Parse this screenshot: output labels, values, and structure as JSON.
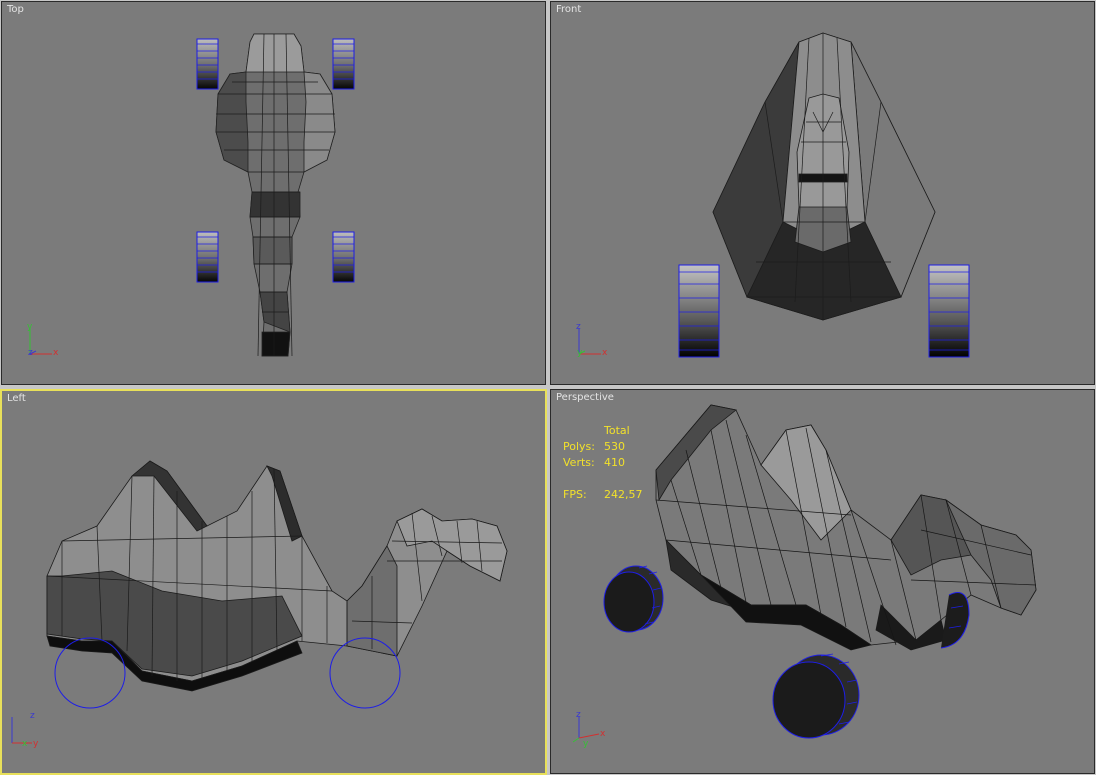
{
  "viewports": [
    {
      "id": "top",
      "label": "Top",
      "axes": {
        "a": "y",
        "b": "x",
        "c": "z"
      }
    },
    {
      "id": "front",
      "label": "Front",
      "axes": {
        "a": "z",
        "b": "x",
        "c": "y"
      }
    },
    {
      "id": "left",
      "label": "Left",
      "axes": {
        "a": "z",
        "b": "y",
        "c": "x"
      }
    },
    {
      "id": "perspective",
      "label": "Perspective",
      "axes": {
        "a": "z",
        "b": "x",
        "c": "y"
      }
    }
  ],
  "active_viewport": "left",
  "stats": {
    "header": "Total",
    "polys_label": "Polys:",
    "polys_value": "530",
    "verts_label": "Verts:",
    "verts_value": "410",
    "fps_label": "FPS:",
    "fps_value": "242,57"
  },
  "colors": {
    "viewport_bg": "#7b7b7b",
    "active_border": "#e8e05a",
    "wheel_wire": "#1e1ee6",
    "stats_text": "#f2e12a",
    "label_text": "#e4e4e4"
  }
}
